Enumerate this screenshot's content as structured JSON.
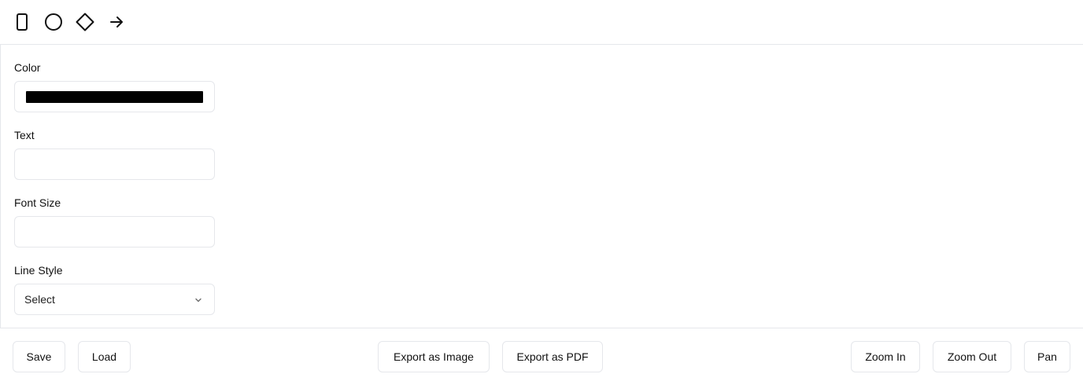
{
  "toolbar": {
    "tools": [
      {
        "name": "rectangle",
        "icon": "rectangle-icon"
      },
      {
        "name": "circle",
        "icon": "circle-icon"
      },
      {
        "name": "diamond",
        "icon": "diamond-icon"
      },
      {
        "name": "arrow",
        "icon": "arrow-right-icon"
      }
    ]
  },
  "properties": {
    "color_label": "Color",
    "color_value": "#000000",
    "text_label": "Text",
    "text_value": "",
    "font_size_label": "Font Size",
    "font_size_value": "",
    "line_style_label": "Line Style",
    "line_style_value": "Select"
  },
  "actions": {
    "save": "Save",
    "load": "Load",
    "export_image": "Export as Image",
    "export_pdf": "Export as PDF",
    "zoom_in": "Zoom In",
    "zoom_out": "Zoom Out",
    "pan": "Pan"
  },
  "colors": {
    "border": "#e5e7eb",
    "text": "#111111",
    "swatch": "#000000"
  }
}
